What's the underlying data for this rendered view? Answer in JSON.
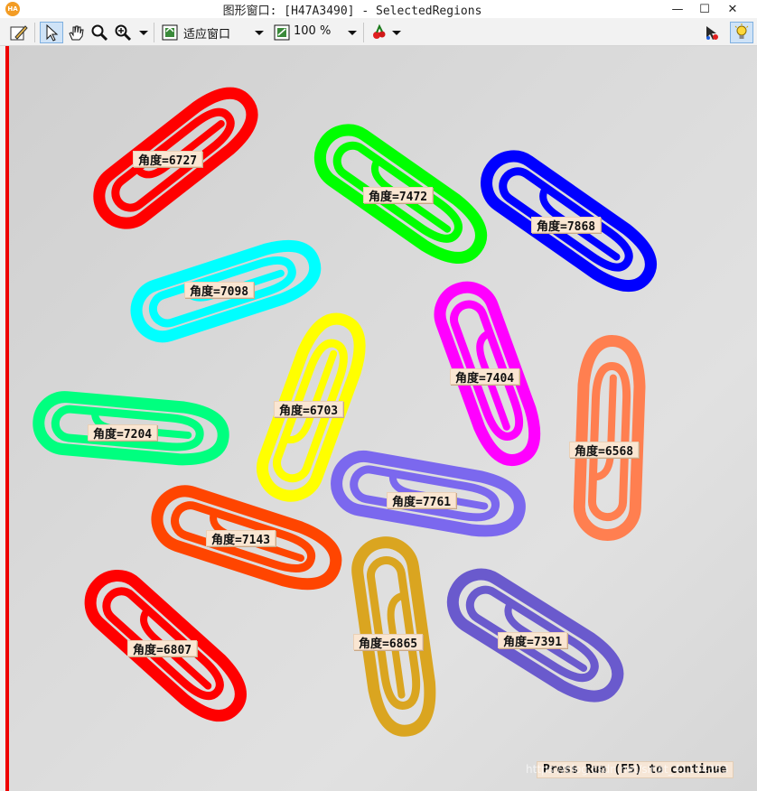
{
  "window": {
    "title": "图形窗口: [H47A3490] - SelectedRegions",
    "app_icon_text": "HA",
    "minimize": "—",
    "maximize": "☐",
    "close": "✕"
  },
  "toolbar": {
    "fit_label": "适应窗口",
    "zoom_value": "100 %",
    "icons": [
      "edit-icon",
      "pointer-icon",
      "hand-icon",
      "magnify-icon",
      "zoom-in-icon",
      "fit-window-icon",
      "zoom-percent-icon",
      "color-icon",
      "inspect-icon",
      "lightbulb-icon"
    ]
  },
  "regions": [
    {
      "color": "#ff0000",
      "label": "角度=6727"
    },
    {
      "color": "#00ff00",
      "label": "角度=7472"
    },
    {
      "color": "#0000ff",
      "label": "角度=7868"
    },
    {
      "color": "#00ffff",
      "label": "角度=7098"
    },
    {
      "color": "#ff00ff",
      "label": "角度=7404"
    },
    {
      "color": "#ffff00",
      "label": "角度=6703"
    },
    {
      "color": "#ff7f50",
      "label": "角度=6568"
    },
    {
      "color": "#00ff7f",
      "label": "角度=7204"
    },
    {
      "color": "#7b68ee",
      "label": "角度=7761"
    },
    {
      "color": "#ff4500",
      "label": "角度=7143"
    },
    {
      "color": "#ff0000",
      "label": "角度=6807"
    },
    {
      "color": "#daa520",
      "label": "角度=6865"
    },
    {
      "color": "#6a5acd",
      "label": "角度=7391"
    }
  ],
  "status": {
    "press_run": "Press Run (F5) to continue",
    "watermark": "https://blog.csdn.net/sinat_41104353"
  }
}
